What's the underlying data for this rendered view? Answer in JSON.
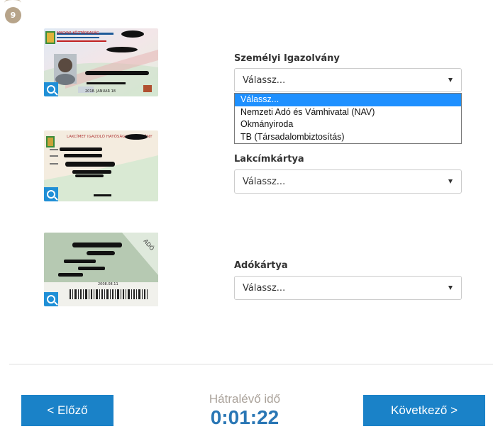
{
  "step": {
    "number": "9"
  },
  "documents": [
    {
      "label": "Személyi Igazolvány",
      "selected": "Válassz...",
      "card_header": "MAGYAR KÖZTÁRSASÁG",
      "card_date": "2018. JANUAR 18",
      "zoom_icon": "magnifier-icon"
    },
    {
      "label": "Lakcímkártya",
      "selected": "Válassz...",
      "card_header": "LAKCÍMET IGAZOLÓ HATÓSÁGI IGAZOLVÁNY",
      "zoom_icon": "magnifier-icon"
    },
    {
      "label": "Adókártya",
      "selected": "Válassz...",
      "card_corner": "ADÓ",
      "card_date": "2008.08.11",
      "zoom_icon": "magnifier-icon"
    }
  ],
  "dropdown_options": [
    "Válassz...",
    "Nemzeti Adó és Vámhivatal (NAV)",
    "Okmányiroda",
    "TB (Társadalombiztosítás)"
  ],
  "footer": {
    "prev_label": "< Előző",
    "next_label": "Következő >",
    "timer_label": "Hátralévő idő",
    "timer_value": "0:01:22"
  },
  "colors": {
    "accent": "#1a82c8",
    "badge": "#b7a48a",
    "option_highlight": "#1e90ff"
  }
}
